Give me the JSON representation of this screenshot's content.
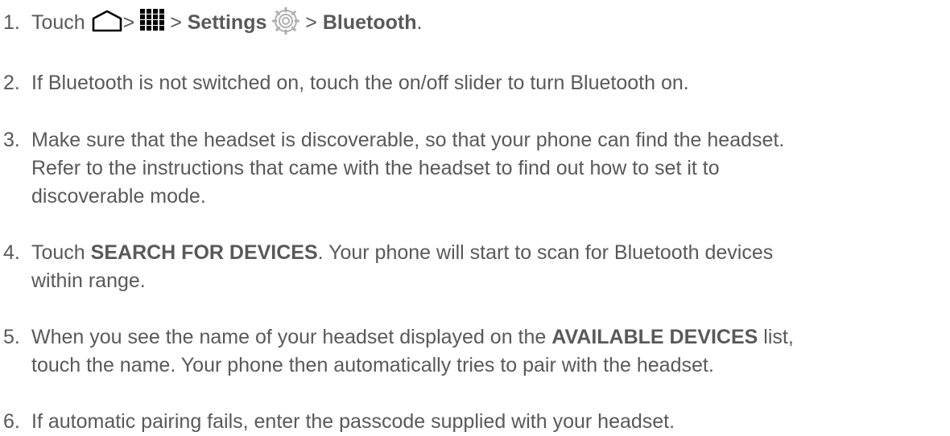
{
  "steps": [
    {
      "number": "1.",
      "parts": {
        "t1": "Touch",
        "sep1": ">",
        "sep2": ">",
        "settings": "Settings",
        "sep3": ">",
        "bluetooth": "Bluetooth",
        "end": "."
      },
      "icons": [
        "home-icon",
        "apps-grid-icon",
        "settings-gear-icon"
      ]
    },
    {
      "number": "2.",
      "lines": [
        "If Bluetooth is not switched on, touch the on/off slider to turn Bluetooth on."
      ]
    },
    {
      "number": "3.",
      "lines": [
        "Make sure that the headset is discoverable, so that your phone can find the headset.",
        "Refer to the instructions that came with the headset to find out how to set it to",
        "discoverable mode."
      ]
    },
    {
      "number": "4.",
      "parts": {
        "t1": "Touch ",
        "bold": "SEARCH FOR DEVICES",
        "t2": ". Your phone will start to scan for Bluetooth devices"
      },
      "lines": [
        "within range."
      ]
    },
    {
      "number": "5.",
      "parts": {
        "t1": "When you see the name of your headset displayed on the ",
        "bold": "AVAILABLE DEVICES",
        "t2": " list,"
      },
      "lines": [
        "touch the name. Your phone then automatically tries to pair with the headset."
      ]
    },
    {
      "number": "6.",
      "lines": [
        "If automatic pairing fails, enter the passcode supplied with your headset."
      ]
    }
  ]
}
